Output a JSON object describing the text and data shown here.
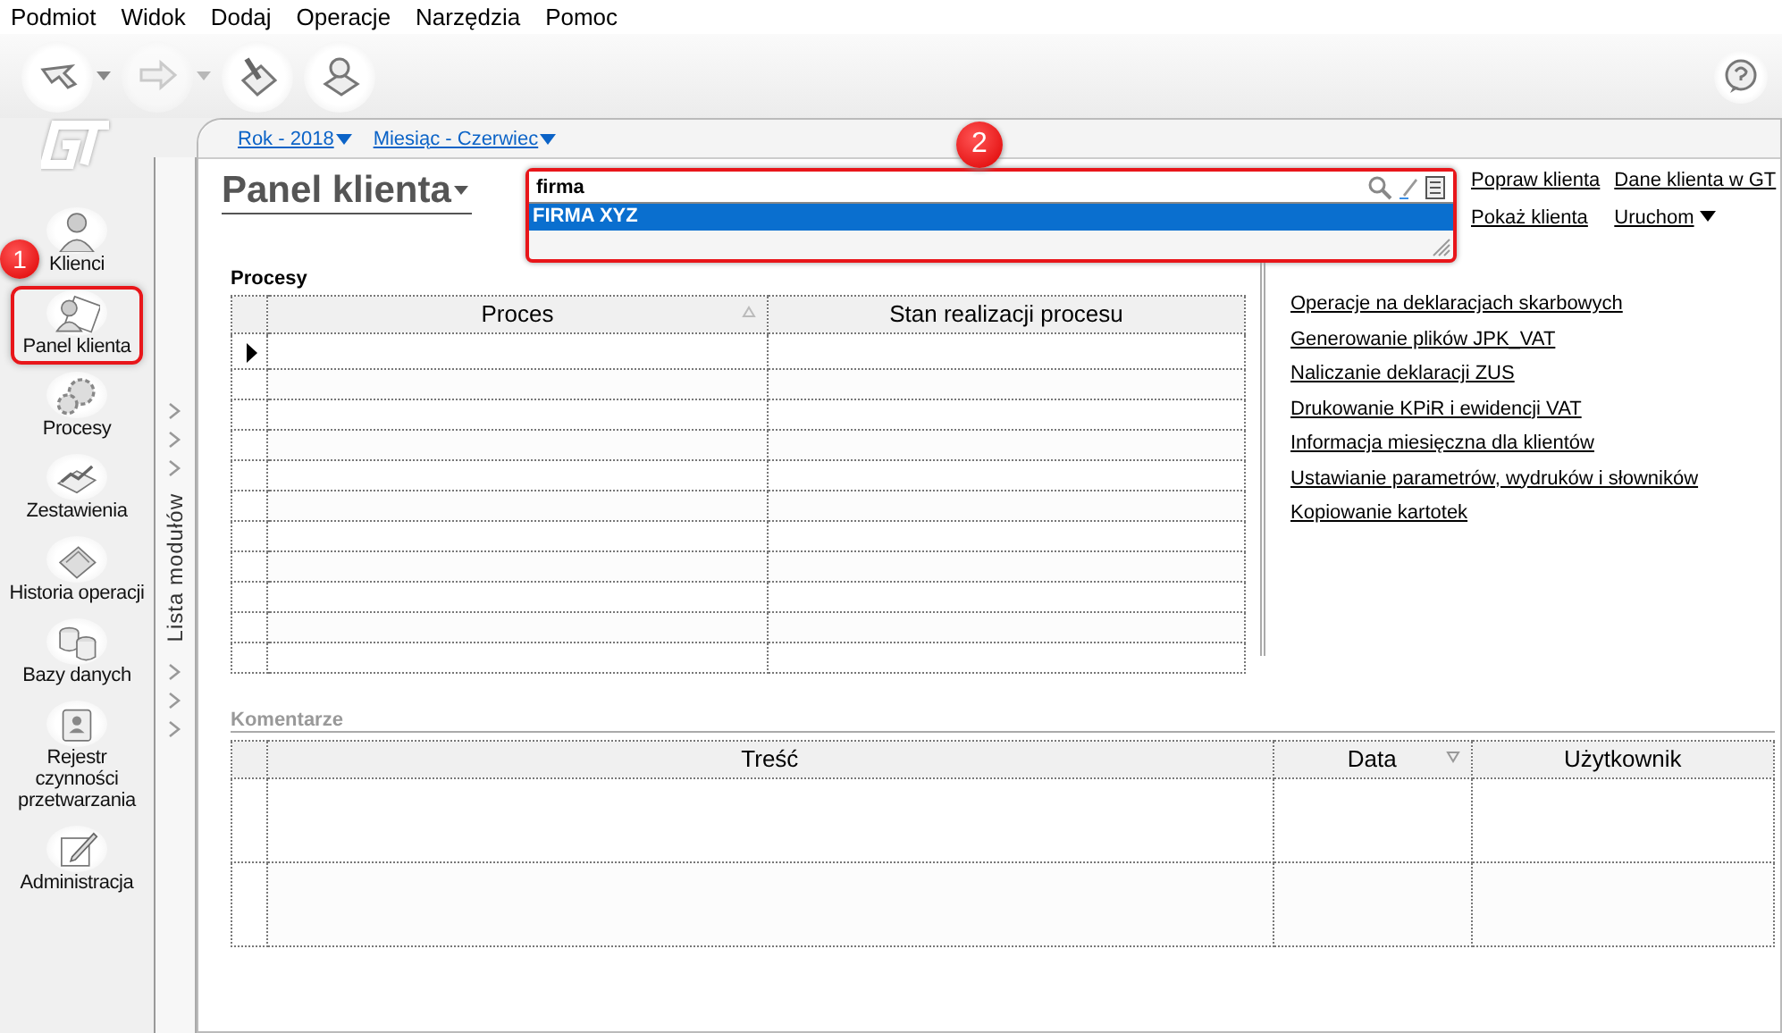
{
  "menu": [
    "Podmiot",
    "Widok",
    "Dodaj",
    "Operacje",
    "Narzędzia",
    "Pomoc"
  ],
  "toolbar": [
    {
      "has_menu": true,
      "disabled": false
    },
    {
      "has_menu": true,
      "disabled": true
    },
    {
      "has_menu": false,
      "disabled": false
    },
    {
      "has_menu": false,
      "disabled": false
    }
  ],
  "sidebar": {
    "items": [
      {
        "label": "Klienci",
        "selected": false
      },
      {
        "label": "Panel klienta",
        "selected": true,
        "callout": "1"
      },
      {
        "label": "Procesy",
        "selected": false
      },
      {
        "label": "Zestawienia",
        "selected": false
      },
      {
        "label": "Historia operacji",
        "selected": false
      },
      {
        "label": "Bazy danych",
        "selected": false
      },
      {
        "label": "Rejestr czynności przetwarzania",
        "selected": false
      },
      {
        "label": "Administracja",
        "selected": false
      }
    ]
  },
  "module_strip": {
    "label": "Lista modułów"
  },
  "filters": [
    "Rok - 2018",
    "Miesiąc - Czerwiec"
  ],
  "panel_title": "Panel klienta",
  "search": {
    "value": "firma",
    "callout": "2",
    "results": [
      {
        "label": "FIRMA XYZ",
        "selected": true
      }
    ]
  },
  "actions": [
    {
      "label": "Popraw klienta",
      "kind": "link"
    },
    {
      "label": "Dane klienta w GT",
      "kind": "link"
    },
    {
      "label": "Pokaż klienta",
      "kind": "link"
    },
    {
      "label": "Uruchom",
      "kind": "menu"
    }
  ],
  "processes": {
    "title": "Procesy",
    "columns": [
      {
        "label": "Proces",
        "sorted": true,
        "ascending": true
      },
      {
        "label": "Stan realizacji procesu",
        "sorted": false
      }
    ]
  },
  "links": [
    "Operacje na deklaracjach skarbowych",
    "Generowanie plików JPK_VAT",
    "Naliczanie deklaracji ZUS",
    "Drukowanie KPiR i ewidencji VAT",
    "Informacja miesięczna dla klientów",
    "Ustawianie parametrów, wydruków i słowników",
    "Kopiowanie kartotek"
  ],
  "comments": {
    "title": "Komentarze",
    "columns": [
      {
        "label": "Treść",
        "sorted": false
      },
      {
        "label": "Data",
        "sorted": true,
        "ascending": false
      },
      {
        "label": "Użytkownik",
        "sorted": false
      }
    ]
  }
}
